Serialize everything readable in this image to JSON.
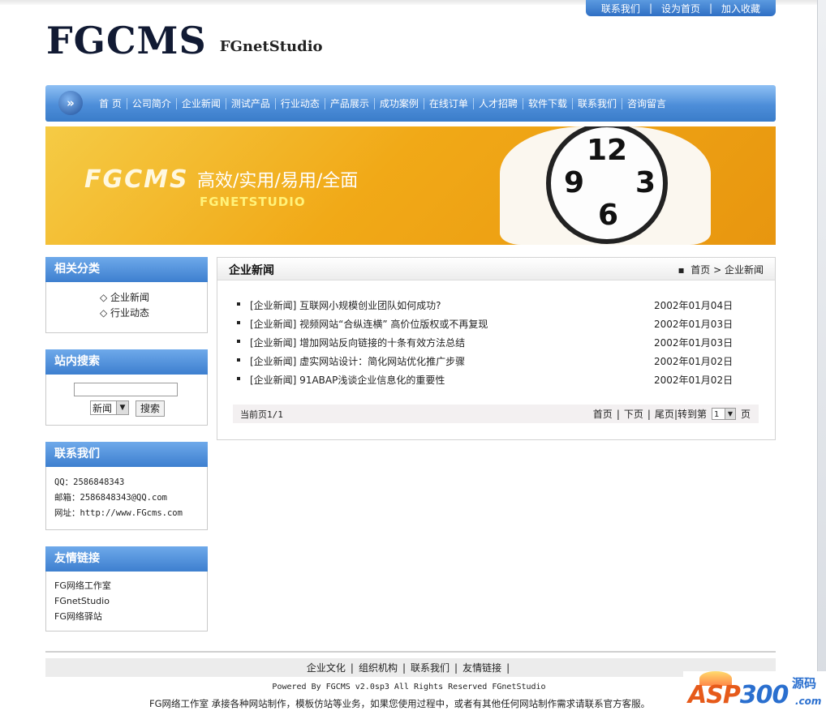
{
  "toplinks": [
    "联系我们",
    "设为首页",
    "加入收藏"
  ],
  "logo": {
    "title": "FGCMS",
    "subtitle": "FGnetStudio"
  },
  "nav": [
    "首 页",
    "公司简介",
    "企业新闻",
    "测试产品",
    "行业动态",
    "产品展示",
    "成功案例",
    "在线订单",
    "人才招聘",
    "软件下载",
    "联系我们",
    "咨询留言"
  ],
  "banner": {
    "brand": "FGCMS",
    "slogan": "高效/实用/易用/全面",
    "studio": "FGNETSTUDIO",
    "clock_numbers": [
      "12",
      "9",
      "3",
      "6"
    ]
  },
  "sidebar": {
    "categories": {
      "title": "相关分类",
      "items": [
        "◇ 企业新闻",
        "◇ 行业动态"
      ]
    },
    "search": {
      "title": "站内搜索",
      "input_value": "",
      "select_value": "新闻",
      "button": "搜索"
    },
    "contact": {
      "title": "联系我们",
      "lines": [
        "QQ：2586848343",
        "邮箱：2586848343@QQ.com",
        "网址：http://www.FGcms.com"
      ]
    },
    "links": {
      "title": "友情链接",
      "items": [
        "FG网络工作室",
        "FGnetStudio",
        "FG网络驿站"
      ]
    }
  },
  "main": {
    "title": "企业新闻",
    "breadcrumb": {
      "home": "首页",
      "sep": ">",
      "current": "企业新闻"
    },
    "news": [
      {
        "title": "[企业新闻] 互联网小规模创业团队如何成功?",
        "date": "2002年01月04日"
      },
      {
        "title": "[企业新闻] 视频网站“合纵连横” 高价位版权或不再复现",
        "date": "2002年01月03日"
      },
      {
        "title": "[企业新闻] 增加网站反向链接的十条有效方法总结",
        "date": "2002年01月03日"
      },
      {
        "title": "[企业新闻] 虚实网站设计：简化网站优化推广步骤",
        "date": "2002年01月02日"
      },
      {
        "title": "[企业新闻] 91ABAP浅谈企业信息化的重要性",
        "date": "2002年01月02日"
      }
    ],
    "pager": {
      "current": "当前页1/1",
      "first": "首页",
      "next": "下页",
      "last": "尾页",
      "goto": "|转到第",
      "page_value": "1",
      "page_unit": "页",
      "sep": "|"
    }
  },
  "footer": {
    "nav": [
      "企业文化",
      "组织机构",
      "联系我们",
      "友情链接"
    ],
    "sep": "|",
    "powered": "Powered By FGCMS v2.0sp3 All Rights Reserved FGnetStudio",
    "note": "FG网络工作室 承接各种网站制作，模板仿站等业务，如果您使用过程中，或者有其他任何网站制作需求请联系官方客服。"
  },
  "watermark": {
    "brand_a": "ASP",
    "brand_b": "300",
    "cn": "源码",
    "com": ".com"
  }
}
